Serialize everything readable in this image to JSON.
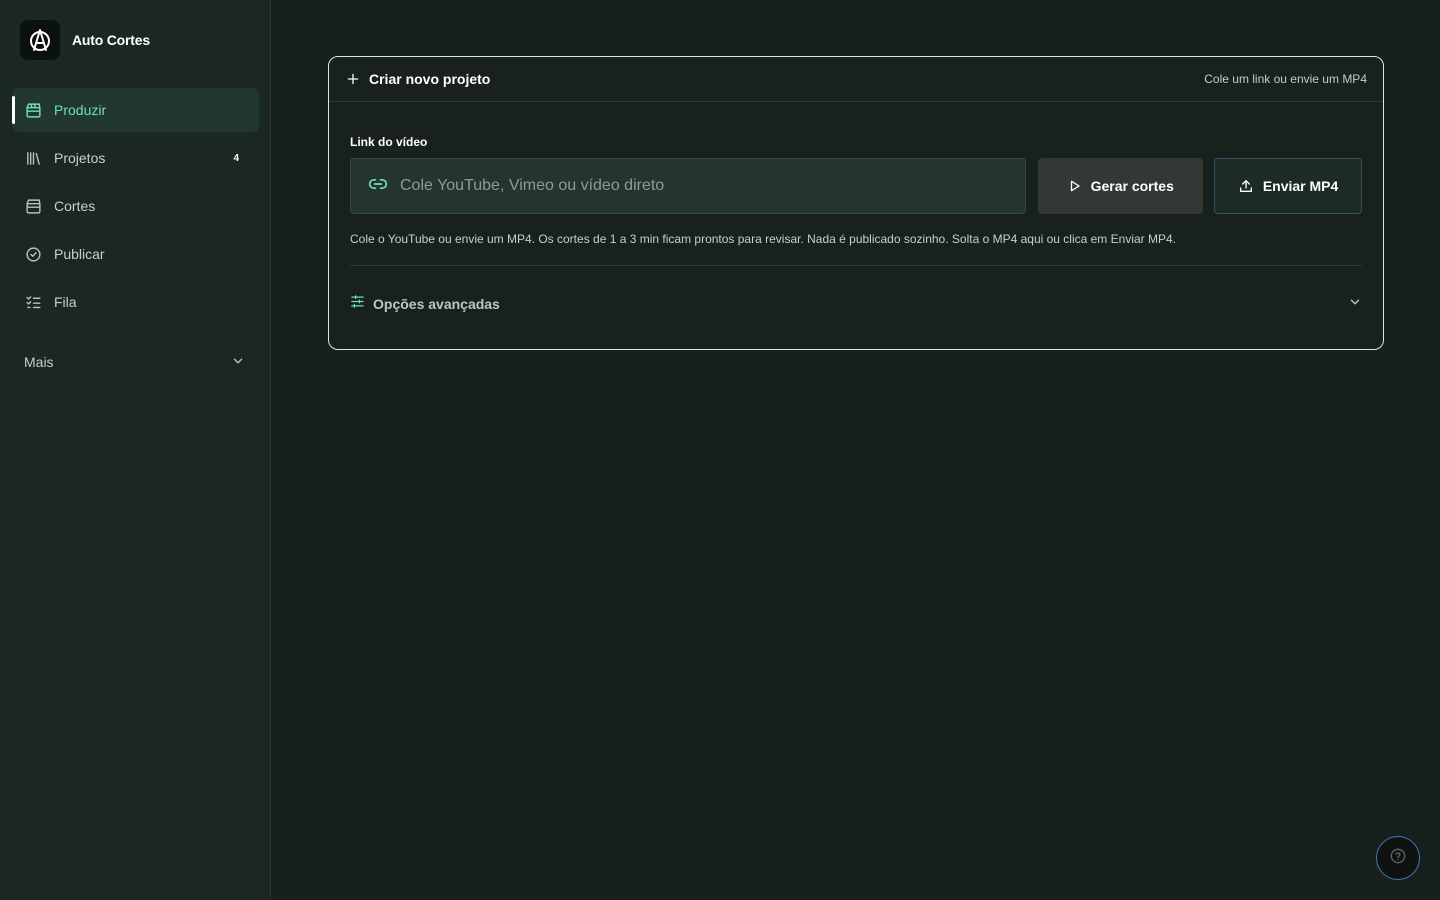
{
  "app": {
    "name": "Auto Cortes",
    "logo_icon": "logo-icon"
  },
  "sidebar": {
    "items": [
      {
        "label": "Produzir",
        "icon": "clapperboard-icon",
        "active": true
      },
      {
        "label": "Projetos",
        "icon": "library-icon",
        "badge": "4"
      },
      {
        "label": "Cortes",
        "icon": "film-icon"
      },
      {
        "label": "Publicar",
        "icon": "check-circle-icon"
      },
      {
        "label": "Fila",
        "icon": "list-checks-icon"
      }
    ],
    "more": {
      "label": "Mais",
      "icon": "chevron-down-icon"
    }
  },
  "card": {
    "title": "Criar novo projeto",
    "hint": "Cole um link ou envie um MP4",
    "field_label": "Link do vídeo",
    "input": {
      "placeholder": "Cole YouTube, Vimeo ou vídeo direto",
      "value": ""
    },
    "generate_label": "Gerar cortes",
    "upload_label": "Enviar MP4",
    "help_text": "Cole o YouTube ou envie um MP4. Os cortes de 1 a 3 min ficam prontos para revisar. Nada é publicado sozinho. Solta o MP4 aqui ou clica em Enviar MP4.",
    "advanced_label": "Opções avançadas"
  },
  "colors": {
    "background": "#17201d",
    "sidebar": "#1b2723",
    "accent": "#6fe0b7",
    "active_bg": "#213730"
  },
  "help_button": {
    "icon": "help-circle-icon"
  }
}
